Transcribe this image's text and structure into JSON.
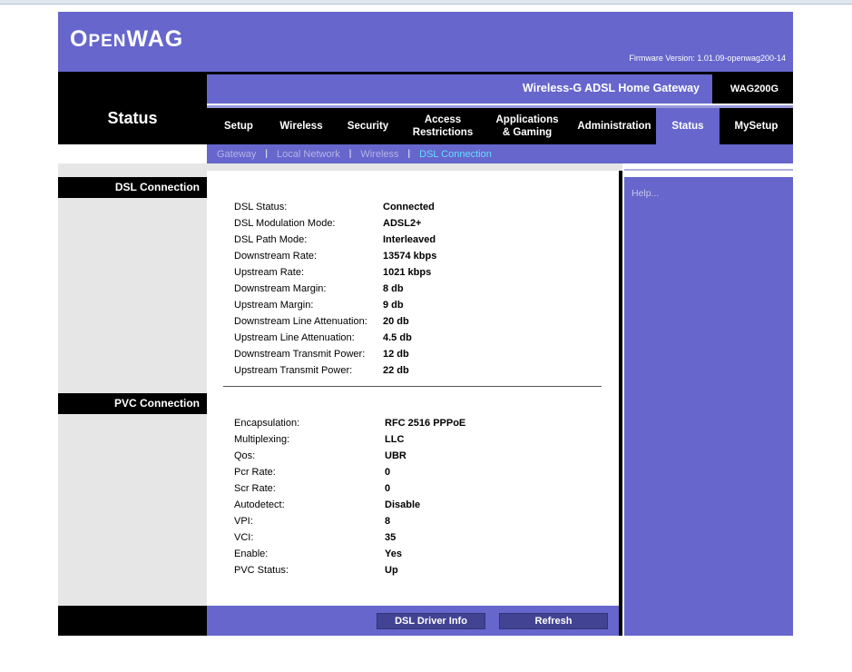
{
  "header": {
    "logo_big1": "O",
    "logo_small1": "PEN",
    "logo_big2": "WAG",
    "firmware": "Firmware Version: 1.01.09-openwag200-14"
  },
  "product": {
    "name": "Wireless-G ADSL Home Gateway",
    "model": "WAG200G"
  },
  "section_title": "Status",
  "menu": [
    {
      "label": "Setup"
    },
    {
      "label": "Wireless"
    },
    {
      "label": "Security"
    },
    {
      "label": "Access Restrictions"
    },
    {
      "label": "Applications & Gaming"
    },
    {
      "label": "Administration"
    },
    {
      "label": "Status"
    },
    {
      "label": "MySetup"
    }
  ],
  "subnav": [
    {
      "label": "Gateway"
    },
    {
      "label": "Local Network"
    },
    {
      "label": "Wireless"
    },
    {
      "label": "DSL Connection"
    }
  ],
  "sidebar": {
    "dsl_header": "DSL Connection",
    "pvc_header": "PVC Connection"
  },
  "dsl": [
    {
      "label": "DSL Status:",
      "value": "Connected"
    },
    {
      "label": "DSL Modulation Mode:",
      "value": "ADSL2+"
    },
    {
      "label": "DSL Path Mode:",
      "value": "Interleaved"
    },
    {
      "label": "Downstream Rate:",
      "value": "13574 kbps"
    },
    {
      "label": "Upstream Rate:",
      "value": "1021 kbps"
    },
    {
      "label": "Downstream Margin:",
      "value": "8 db"
    },
    {
      "label": "Upstream Margin:",
      "value": "9 db"
    },
    {
      "label": "Downstream Line Attenuation:",
      "value": "20 db"
    },
    {
      "label": "Upstream Line Attenuation:",
      "value": "4.5 db"
    },
    {
      "label": "Downstream Transmit Power:",
      "value": "12 db"
    },
    {
      "label": "Upstream Transmit Power:",
      "value": "22 db"
    }
  ],
  "pvc": [
    {
      "label": "Encapsulation:",
      "value": "RFC 2516 PPPoE"
    },
    {
      "label": "Multiplexing:",
      "value": "LLC"
    },
    {
      "label": "Qos:",
      "value": "UBR"
    },
    {
      "label": "Pcr Rate:",
      "value": "0"
    },
    {
      "label": "Scr Rate:",
      "value": "0"
    },
    {
      "label": "Autodetect:",
      "value": "Disable"
    },
    {
      "label": "VPI:",
      "value": "8"
    },
    {
      "label": "VCI:",
      "value": "35"
    },
    {
      "label": "Enable:",
      "value": "Yes"
    },
    {
      "label": "PVC Status:",
      "value": "Up"
    }
  ],
  "help": "Help...",
  "buttons": {
    "driver_info": "DSL Driver Info",
    "refresh": "Refresh"
  },
  "colors": {
    "accent": "#6666cc",
    "active_subnav": "#66ddff"
  }
}
